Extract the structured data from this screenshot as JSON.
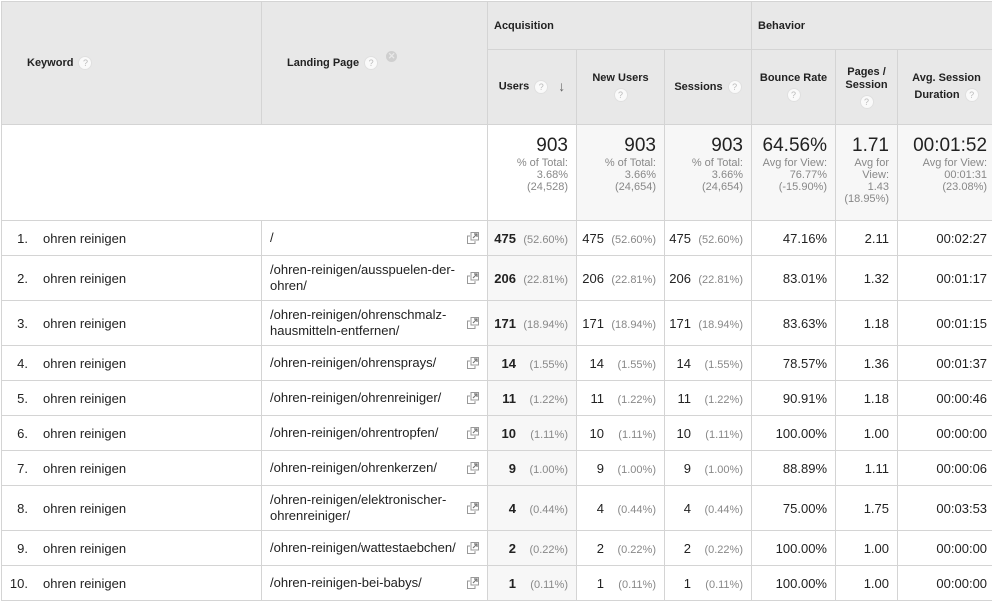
{
  "headers": {
    "keyword": "Keyword",
    "landing_page": "Landing Page",
    "acquisition": "Acquisition",
    "behavior": "Behavior",
    "users": "Users",
    "new_users": "New Users",
    "sessions": "Sessions",
    "bounce_rate": "Bounce Rate",
    "pages_session_1": "Pages /",
    "pages_session_2": "Session",
    "avg_duration_1": "Avg. Session",
    "avg_duration_2": "Duration",
    "help_glyph": "?",
    "remove_glyph": "✕",
    "sort_glyph": "↓"
  },
  "totals": {
    "users": {
      "value": "903",
      "l1": "% of Total:",
      "l2": "3.68%",
      "l3": "(24,528)"
    },
    "new_users": {
      "value": "903",
      "l1": "% of Total:",
      "l2": "3.66%",
      "l3": "(24,654)"
    },
    "sessions": {
      "value": "903",
      "l1": "% of Total:",
      "l2": "3.66%",
      "l3": "(24,654)"
    },
    "bounce_rate": {
      "value": "64.56%",
      "l1": "Avg for View:",
      "l2": "76.77%",
      "l3": "(-15.90%)"
    },
    "pages_session": {
      "value": "1.71",
      "l1": "Avg for",
      "l2": "View:",
      "l3": "1.43",
      "l4": "(18.95%)"
    },
    "avg_duration": {
      "value": "00:01:52",
      "l1": "Avg for View:",
      "l2": "00:01:31",
      "l3": "(23.08%)"
    }
  },
  "rows": [
    {
      "idx": "1.",
      "keyword": "ohren reinigen",
      "page": "/",
      "users": "475",
      "users_pct": "(52.60%)",
      "new_users": "475",
      "new_users_pct": "(52.60%)",
      "sessions": "475",
      "sessions_pct": "(52.60%)",
      "bounce": "47.16%",
      "pps": "2.11",
      "dur": "00:02:27"
    },
    {
      "idx": "2.",
      "keyword": "ohren reinigen",
      "page": "/ohren-reinigen/ausspuelen-der-ohren/",
      "users": "206",
      "users_pct": "(22.81%)",
      "new_users": "206",
      "new_users_pct": "(22.81%)",
      "sessions": "206",
      "sessions_pct": "(22.81%)",
      "bounce": "83.01%",
      "pps": "1.32",
      "dur": "00:01:17"
    },
    {
      "idx": "3.",
      "keyword": "ohren reinigen",
      "page": "/ohren-reinigen/ohrenschmalz-hausmitteln-entfernen/",
      "users": "171",
      "users_pct": "(18.94%)",
      "new_users": "171",
      "new_users_pct": "(18.94%)",
      "sessions": "171",
      "sessions_pct": "(18.94%)",
      "bounce": "83.63%",
      "pps": "1.18",
      "dur": "00:01:15"
    },
    {
      "idx": "4.",
      "keyword": "ohren reinigen",
      "page": "/ohren-reinigen/ohrensprays/",
      "users": "14",
      "users_pct": "(1.55%)",
      "new_users": "14",
      "new_users_pct": "(1.55%)",
      "sessions": "14",
      "sessions_pct": "(1.55%)",
      "bounce": "78.57%",
      "pps": "1.36",
      "dur": "00:01:37"
    },
    {
      "idx": "5.",
      "keyword": "ohren reinigen",
      "page": "/ohren-reinigen/ohrenreiniger/",
      "users": "11",
      "users_pct": "(1.22%)",
      "new_users": "11",
      "new_users_pct": "(1.22%)",
      "sessions": "11",
      "sessions_pct": "(1.22%)",
      "bounce": "90.91%",
      "pps": "1.18",
      "dur": "00:00:46"
    },
    {
      "idx": "6.",
      "keyword": "ohren reinigen",
      "page": "/ohren-reinigen/ohrentropfen/",
      "users": "10",
      "users_pct": "(1.11%)",
      "new_users": "10",
      "new_users_pct": "(1.11%)",
      "sessions": "10",
      "sessions_pct": "(1.11%)",
      "bounce": "100.00%",
      "pps": "1.00",
      "dur": "00:00:00"
    },
    {
      "idx": "7.",
      "keyword": "ohren reinigen",
      "page": "/ohren-reinigen/ohrenkerzen/",
      "users": "9",
      "users_pct": "(1.00%)",
      "new_users": "9",
      "new_users_pct": "(1.00%)",
      "sessions": "9",
      "sessions_pct": "(1.00%)",
      "bounce": "88.89%",
      "pps": "1.11",
      "dur": "00:00:06"
    },
    {
      "idx": "8.",
      "keyword": "ohren reinigen",
      "page": "/ohren-reinigen/elektronischer-ohrenreiniger/",
      "users": "4",
      "users_pct": "(0.44%)",
      "new_users": "4",
      "new_users_pct": "(0.44%)",
      "sessions": "4",
      "sessions_pct": "(0.44%)",
      "bounce": "75.00%",
      "pps": "1.75",
      "dur": "00:03:53"
    },
    {
      "idx": "9.",
      "keyword": "ohren reinigen",
      "page": "/ohren-reinigen/wattestaebchen/",
      "users": "2",
      "users_pct": "(0.22%)",
      "new_users": "2",
      "new_users_pct": "(0.22%)",
      "sessions": "2",
      "sessions_pct": "(0.22%)",
      "bounce": "100.00%",
      "pps": "1.00",
      "dur": "00:00:00"
    },
    {
      "idx": "10.",
      "keyword": "ohren reinigen",
      "page": "/ohren-reinigen-bei-babys/",
      "users": "1",
      "users_pct": "(0.11%)",
      "new_users": "1",
      "new_users_pct": "(0.11%)",
      "sessions": "1",
      "sessions_pct": "(0.11%)",
      "bounce": "100.00%",
      "pps": "1.00",
      "dur": "00:00:00"
    }
  ]
}
